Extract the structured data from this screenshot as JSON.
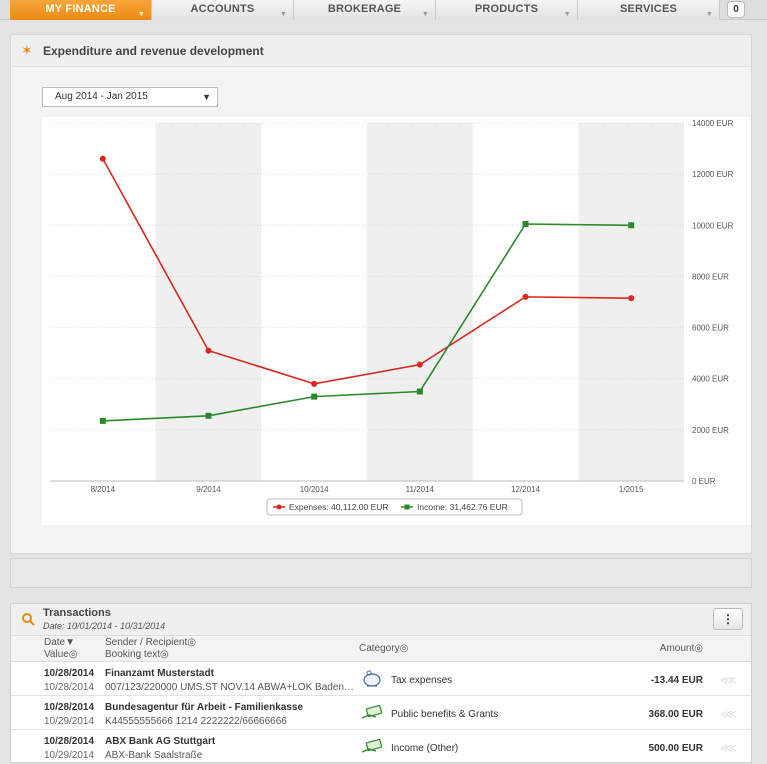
{
  "nav": {
    "items": [
      {
        "label": "MY FINANCE",
        "active": true
      },
      {
        "label": "ACCOUNTS",
        "active": false
      },
      {
        "label": "BROKERAGE",
        "active": false
      },
      {
        "label": "PRODUCTS",
        "active": false
      },
      {
        "label": "SERVICES",
        "active": false
      }
    ],
    "badge": "0"
  },
  "chart_panel": {
    "title": "Expenditure and revenue development",
    "period_select": "Aug 2014 - Jan 2015"
  },
  "chart_data": {
    "type": "line",
    "categories": [
      "8/2014",
      "9/2014",
      "10/2014",
      "11/2014",
      "12/2014",
      "1/2015"
    ],
    "series": [
      {
        "name": "Expenses",
        "color": "#d9261c",
        "values": [
          12600,
          5100,
          3800,
          4550,
          7200,
          7150
        ]
      },
      {
        "name": "Income",
        "color": "#2a8a2a",
        "values": [
          2350,
          2550,
          3300,
          3500,
          10050,
          10000
        ]
      }
    ],
    "y_ticks": [
      "0 EUR",
      "2000 EUR",
      "4000 EUR",
      "6000 EUR",
      "8000 EUR",
      "10000 EUR",
      "12000 EUR",
      "14000 EUR"
    ],
    "ylim": [
      0,
      14000
    ],
    "legend": {
      "expenses": "Expenses: 40,112.00 EUR",
      "income": "Income: 31,462.76 EUR"
    }
  },
  "transactions": {
    "title": "Transactions",
    "date_range": "Date: 10/01/2014 - 10/31/2014",
    "menu_icon": "⋮",
    "columns": {
      "date": "Date▼",
      "value": "Value◎",
      "sender": "Sender / Recipient◎",
      "booking": "Booking text◎",
      "category": "Category◎",
      "amount": "Amount◎"
    },
    "rows": [
      {
        "date": "10/28/2014",
        "value": "10/28/2014",
        "sender": "Finanzamt Musterstadt",
        "booking": "007/123/220000 UMS.ST NOV.14 ABWA+LOK Baden-...",
        "category": "Tax expenses",
        "icon": "piggy-bank-icon",
        "amount": "-13.44 EUR"
      },
      {
        "date": "10/28/2014",
        "value": "10/29/2014",
        "sender": "Bundesagentur für Arbeit - Familienkasse",
        "booking": "K44555555666 1214 2222222/66666666",
        "category": "Public benefits & Grants",
        "icon": "money-hand-icon",
        "amount": "368.00 EUR"
      },
      {
        "date": "10/28/2014",
        "value": "10/29/2014",
        "sender": "ABX Bank AG Stuttgart",
        "booking": "ABX-Bank Saalstraße",
        "category": "Income (Other)",
        "icon": "money-hand-icon",
        "amount": "500.00 EUR"
      }
    ]
  }
}
